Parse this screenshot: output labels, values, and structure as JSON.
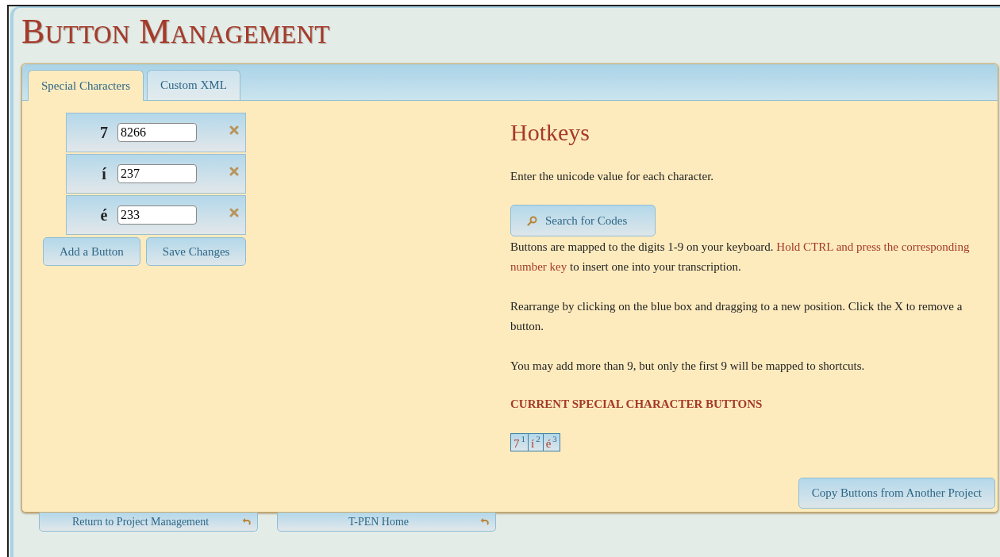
{
  "title": "Button Management",
  "tabs": [
    {
      "label": "Special Characters",
      "selected": true
    },
    {
      "label": "Custom XML",
      "selected": false
    }
  ],
  "character_buttons": [
    {
      "character": "7",
      "code": "8266"
    },
    {
      "character": "í",
      "code": "237"
    },
    {
      "character": "é",
      "code": "233"
    }
  ],
  "actions": [
    "Add a Button",
    "Save Changes"
  ],
  "hotkeys": {
    "heading": "Hotkeys",
    "intro": "Enter the unicode value for each character.",
    "search_button": "Search for Codes",
    "paragraphs": [
      [
        {
          "text": "Buttons are mapped to the digits 1-9 on your keyboard. ",
          "kind": "plain"
        },
        {
          "text": "Hold CTRL and press the corresponding number key",
          "kind": "emphasis"
        },
        {
          "text": " to insert one into your transcription.",
          "kind": "plain"
        }
      ],
      [
        {
          "text": "Rearrange by clicking on the blue box and dragging to a new position. Click the X to remove a button.",
          "kind": "plain"
        }
      ],
      [
        {
          "text": "You may add more than 9, but only the first 9 will be mapped to shortcuts.",
          "kind": "plain"
        }
      ]
    ],
    "current_heading": "CURRENT SPECIAL CHARACTER BUTTONS",
    "current_buttons": [
      {
        "character": "7",
        "number": "1"
      },
      {
        "character": "í",
        "number": "2"
      },
      {
        "character": "é",
        "number": "3"
      }
    ],
    "copy_button": "Copy Buttons from Another Project"
  },
  "footer_links": [
    "Return to Project Management",
    "T-PEN Home"
  ]
}
